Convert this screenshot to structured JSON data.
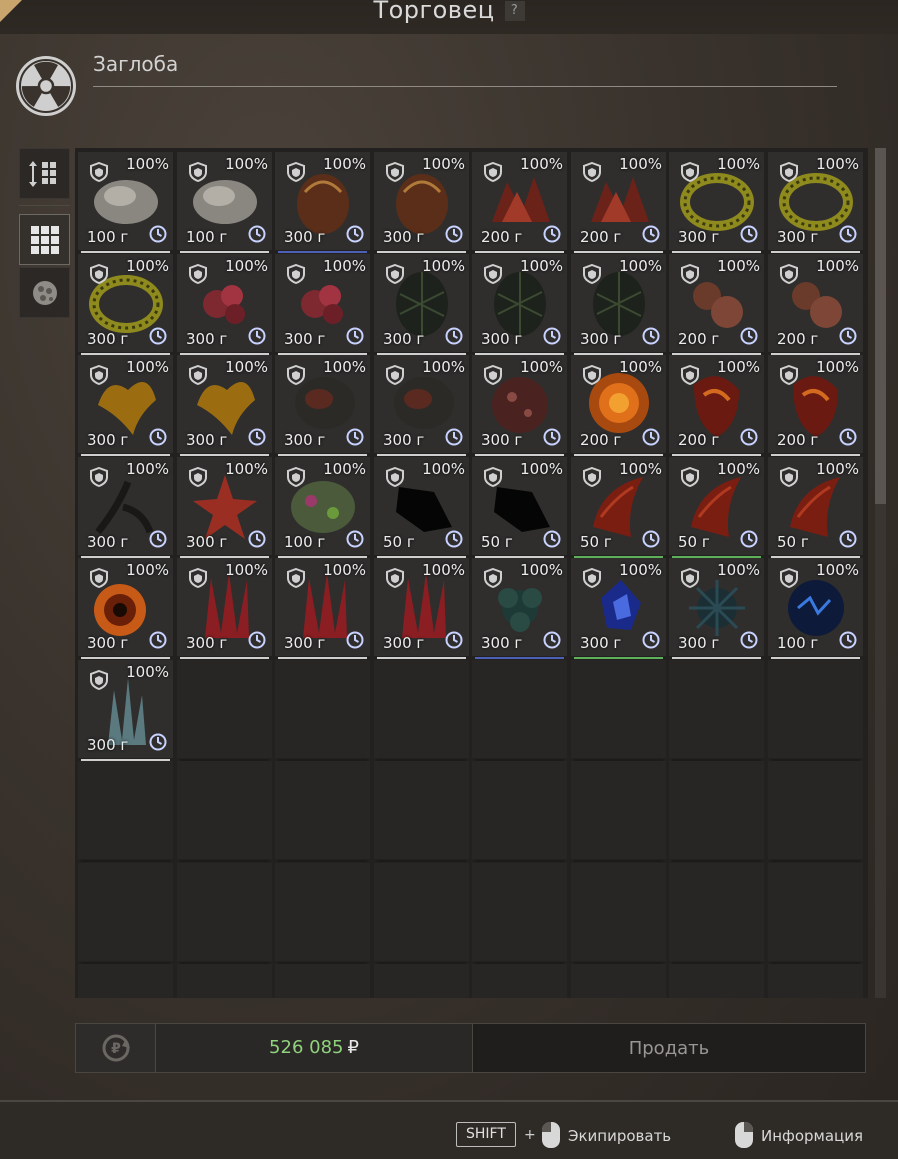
{
  "window": {
    "title": "Торговец",
    "help": "?"
  },
  "header": {
    "name": "Заглоба"
  },
  "sidebar": {
    "tabs": [
      {
        "name": "sort",
        "icon": "sort-grid-icon",
        "active": false
      },
      {
        "name": "grid",
        "icon": "grid-icon",
        "active": true
      },
      {
        "name": "artifacts",
        "icon": "artifact-icon",
        "active": false
      }
    ]
  },
  "inventory": {
    "items": [
      {
        "pct": "100%",
        "weight": "100 г",
        "art": "gray-rock",
        "rarity": "white"
      },
      {
        "pct": "100%",
        "weight": "100 г",
        "art": "gray-rock",
        "rarity": "white"
      },
      {
        "pct": "100%",
        "weight": "300 г",
        "art": "brown-pod",
        "rarity": "blue"
      },
      {
        "pct": "100%",
        "weight": "300 г",
        "art": "brown-pod",
        "rarity": "white"
      },
      {
        "pct": "100%",
        "weight": "200 г",
        "art": "red-crystal",
        "rarity": "white"
      },
      {
        "pct": "100%",
        "weight": "200 г",
        "art": "red-crystal",
        "rarity": "white"
      },
      {
        "pct": "100%",
        "weight": "300 г",
        "art": "yellow-ring",
        "rarity": "white"
      },
      {
        "pct": "100%",
        "weight": "300 г",
        "art": "yellow-ring",
        "rarity": "white"
      },
      {
        "pct": "100%",
        "weight": "300 г",
        "art": "yellow-ring",
        "rarity": "white"
      },
      {
        "pct": "100%",
        "weight": "300 г",
        "art": "pink-coral",
        "rarity": "white"
      },
      {
        "pct": "100%",
        "weight": "300 г",
        "art": "pink-coral",
        "rarity": "white"
      },
      {
        "pct": "100%",
        "weight": "300 г",
        "art": "dark-mesh",
        "rarity": "white"
      },
      {
        "pct": "100%",
        "weight": "300 г",
        "art": "dark-mesh",
        "rarity": "white"
      },
      {
        "pct": "100%",
        "weight": "300 г",
        "art": "dark-mesh",
        "rarity": "white"
      },
      {
        "pct": "100%",
        "weight": "200 г",
        "art": "brown-lump",
        "rarity": "white"
      },
      {
        "pct": "100%",
        "weight": "200 г",
        "art": "brown-lump",
        "rarity": "white"
      },
      {
        "pct": "100%",
        "weight": "300 г",
        "art": "yellow-blob",
        "rarity": "white"
      },
      {
        "pct": "100%",
        "weight": "300 г",
        "art": "yellow-blob",
        "rarity": "white"
      },
      {
        "pct": "100%",
        "weight": "300 г",
        "art": "dark-stone",
        "rarity": "white"
      },
      {
        "pct": "100%",
        "weight": "300 г",
        "art": "dark-stone",
        "rarity": "white"
      },
      {
        "pct": "100%",
        "weight": "300 г",
        "art": "red-sphere",
        "rarity": "white"
      },
      {
        "pct": "100%",
        "weight": "200 г",
        "art": "fire-orb",
        "rarity": "white"
      },
      {
        "pct": "100%",
        "weight": "200 г",
        "art": "lava-shell",
        "rarity": "white"
      },
      {
        "pct": "100%",
        "weight": "200 г",
        "art": "lava-shell",
        "rarity": "white"
      },
      {
        "pct": "100%",
        "weight": "300 г",
        "art": "black-branch",
        "rarity": "white"
      },
      {
        "pct": "100%",
        "weight": "300 г",
        "art": "red-star",
        "rarity": "white"
      },
      {
        "pct": "100%",
        "weight": "100 г",
        "art": "mossy-rock",
        "rarity": "white"
      },
      {
        "pct": "100%",
        "weight": "50 г",
        "art": "black-shard",
        "rarity": "white"
      },
      {
        "pct": "100%",
        "weight": "50 г",
        "art": "black-shard",
        "rarity": "white"
      },
      {
        "pct": "100%",
        "weight": "50 г",
        "art": "red-horn",
        "rarity": "green"
      },
      {
        "pct": "100%",
        "weight": "50 г",
        "art": "red-horn",
        "rarity": "green"
      },
      {
        "pct": "100%",
        "weight": "50 г",
        "art": "red-horn",
        "rarity": "white"
      },
      {
        "pct": "100%",
        "weight": "300 г",
        "art": "orange-vortex",
        "rarity": "white"
      },
      {
        "pct": "100%",
        "weight": "300 г",
        "art": "red-spikes",
        "rarity": "white"
      },
      {
        "pct": "100%",
        "weight": "300 г",
        "art": "red-spikes",
        "rarity": "white"
      },
      {
        "pct": "100%",
        "weight": "300 г",
        "art": "red-spikes",
        "rarity": "white"
      },
      {
        "pct": "100%",
        "weight": "300 г",
        "art": "teal-flower",
        "rarity": "blue"
      },
      {
        "pct": "100%",
        "weight": "300 г",
        "art": "blue-crystal",
        "rarity": "green"
      },
      {
        "pct": "100%",
        "weight": "300 г",
        "art": "teal-spiky",
        "rarity": "white"
      },
      {
        "pct": "100%",
        "weight": "100 г",
        "art": "blue-electric",
        "rarity": "white"
      },
      {
        "pct": "100%",
        "weight": "300 г",
        "art": "ice-crystal",
        "rarity": "white"
      }
    ],
    "total_slots": 72
  },
  "bottom": {
    "balance": "526 085",
    "currency": "₽",
    "sell_label": "Продать"
  },
  "footer": {
    "shift_key": "SHIFT",
    "plus": "+",
    "equip_label": "Экипировать",
    "info_label": "Информация"
  },
  "colors": {
    "balance": "#8fd27c",
    "rarity_green": "#5fb05a",
    "rarity_blue": "#4e5fb8"
  }
}
